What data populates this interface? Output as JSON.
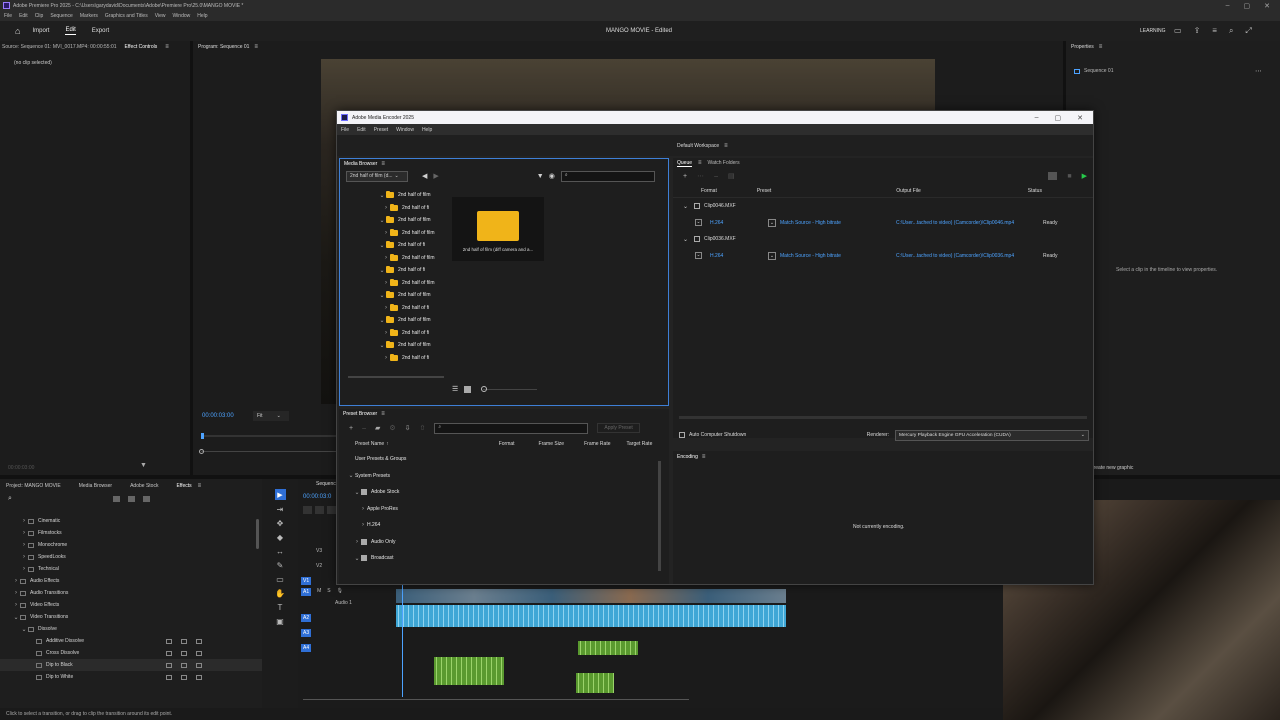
{
  "premiere": {
    "title_bar": "Adobe Premiere Pro 2025 - C:\\Users\\garydavid\\Documents\\Adobe\\Premiere Pro\\25.0\\MANGO MOVIE *",
    "menu": [
      "File",
      "Edit",
      "Clip",
      "Sequence",
      "Markers",
      "Graphics and Titles",
      "View",
      "Window",
      "Help"
    ],
    "nav": {
      "import": "Import",
      "edit": "Edit",
      "export": "Export"
    },
    "project_title": "MANGO MOVIE - Edited",
    "learning": "LEARNING",
    "source_tab": "Source: Sequence 01: MVI_0017.MP4: 00:00:55:01",
    "effect_controls_tab": "Effect Controls",
    "no_clip": "(no clip selected)",
    "program_tab": "Program: Sequence 01",
    "timecode": "00:00:03:00",
    "fit": "Fit",
    "properties_tab": "Properties",
    "sequence_label": "Sequence 01",
    "properties_hint": "Select a clip in the timeline to view properties.",
    "create_graphic": "Create new graphic",
    "left_timecode": "00:00:03:00",
    "project_tabs": [
      "Project: MANGO MOVIE",
      "Media Browser",
      "Adobe Stock",
      "Effects"
    ],
    "effects_tree": [
      {
        "label": "Cinematic",
        "indent": 1
      },
      {
        "label": "Filmstocks",
        "indent": 1
      },
      {
        "label": "Monochrome",
        "indent": 1
      },
      {
        "label": "SpeedLooks",
        "indent": 1
      },
      {
        "label": "Technical",
        "indent": 1
      },
      {
        "label": "Audio Effects",
        "indent": 0
      },
      {
        "label": "Audio Transitions",
        "indent": 0
      },
      {
        "label": "Video Effects",
        "indent": 0
      },
      {
        "label": "Video Transitions",
        "indent": 0
      },
      {
        "label": "Dissolve",
        "indent": 1
      },
      {
        "label": "Additive Dissolve",
        "indent": 2
      },
      {
        "label": "Cross Dissolve",
        "indent": 2
      },
      {
        "label": "Dip to Black",
        "indent": 2
      },
      {
        "label": "Dip to White",
        "indent": 2
      }
    ],
    "timeline_tab": "Sequence 01",
    "timeline_timecode": "00:00:03:0",
    "tracks": [
      "V3",
      "V2",
      "V1",
      "A1",
      "A2",
      "A3",
      "A4"
    ],
    "audio1_label": "Audio 1",
    "status_bar": "Click to select a transition, or drag to clip the transition around its edit point."
  },
  "encoder": {
    "title": "Adobe Media Encoder 2025",
    "menu": [
      "File",
      "Edit",
      "Preset",
      "Window",
      "Help"
    ],
    "workspace": "Default Workspace",
    "media_browser_tab": "Media Browser",
    "location": "2nd half of film (d...",
    "tree_items": [
      "2nd half of film",
      "2nd half of fi",
      "2nd half of film",
      "2nd half of film",
      "2nd half of fi",
      "2nd half of film",
      "2nd half of fi",
      "2nd half of film",
      "2nd half of film",
      "2nd half of fi",
      "2nd half of film",
      "2nd half of fi",
      "2nd half of film",
      "2nd half of fi"
    ],
    "folder_thumb_label": "2nd half of film (diff camera and a...",
    "queue_tab": "Queue",
    "watch_folders_tab": "Watch Folders",
    "queue_headers": {
      "format": "Format",
      "preset": "Preset",
      "output": "Output File",
      "status": "Status"
    },
    "queue_items": [
      {
        "clip": "Clip0046.MXF",
        "format": "H.264",
        "preset": "Match Source - High bitrate",
        "output": "C:\\User...tached to video) (Camcorder)\\Clip0046.mp4",
        "status": "Ready"
      },
      {
        "clip": "Clip0036.MXF",
        "format": "H.264",
        "preset": "Match Source - High bitrate",
        "output": "C:\\User...tached to video) (Camcorder)\\Clip0036.mp4",
        "status": "Ready"
      }
    ],
    "auto_shutdown": "Auto Computer Shutdown",
    "renderer_label": "Renderer:",
    "renderer_value": "Mercury Playback Engine GPU Acceleration (CUDA)",
    "preset_browser_tab": "Preset Browser",
    "apply_preset": "Apply Preset",
    "preset_headers": {
      "name": "Preset Name",
      "format": "Format",
      "frame_size": "Frame Size",
      "frame_rate": "Frame Rate",
      "target_rate": "Target Rate"
    },
    "preset_tree": [
      {
        "label": "User Presets & Groups",
        "indent": 0,
        "chev": ""
      },
      {
        "label": "System Presets",
        "indent": 0,
        "chev": "v"
      },
      {
        "label": "Adobe Stock",
        "indent": 1,
        "chev": "v"
      },
      {
        "label": "Apple ProRes",
        "indent": 2,
        "chev": ">"
      },
      {
        "label": "H.264",
        "indent": 2,
        "chev": ">"
      },
      {
        "label": "Audio Only",
        "indent": 1,
        "chev": ">"
      },
      {
        "label": "Broadcast",
        "indent": 1,
        "chev": "v"
      }
    ],
    "encoding_tab": "Encoding",
    "not_encoding": "Not currently encoding."
  },
  "colors": {
    "accent": "#4da3ff",
    "folder": "#f0b419",
    "audio_clip": "#3fa7d6",
    "video_green": "#7bc043"
  }
}
